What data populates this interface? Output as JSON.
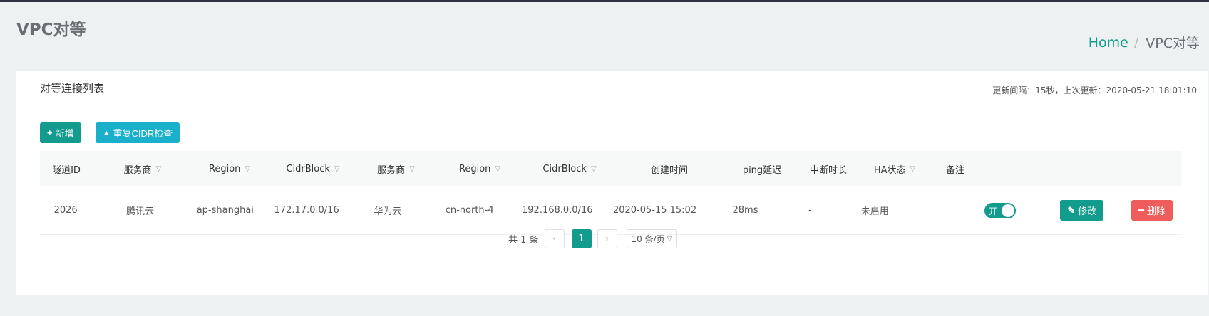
{
  "page": {
    "title": "VPC对等"
  },
  "breadcrumb": {
    "home": "Home",
    "separator": "/",
    "current": "VPC对等"
  },
  "card": {
    "title": "对等连接列表",
    "update_info": "更新间隔：15秒，上次更新：2020-05-21 18:01:10"
  },
  "toolbar": {
    "add_label": "新增",
    "add_icon": "+",
    "check_label": "重复CIDR检查",
    "check_icon": "▲"
  },
  "table": {
    "columns": [
      {
        "label": "隧道ID",
        "filter": false
      },
      {
        "label": "服务商",
        "filter": true
      },
      {
        "label": "Region",
        "filter": true
      },
      {
        "label": "CidrBlock",
        "filter": true
      },
      {
        "label": "服务商",
        "filter": true
      },
      {
        "label": "Region",
        "filter": true
      },
      {
        "label": "CidrBlock",
        "filter": true
      },
      {
        "label": "创建时间",
        "filter": false
      },
      {
        "label": "ping延迟",
        "filter": false
      },
      {
        "label": "中断时长",
        "filter": false
      },
      {
        "label": "HA状态",
        "filter": true
      },
      {
        "label": "备注",
        "filter": false
      }
    ],
    "rows": [
      {
        "tunnel_id": "2026",
        "provider_a": "腾讯云",
        "region_a": "ap-shanghai",
        "cidr_a": "172.17.0.0/16",
        "provider_b": "华为云",
        "region_b": "cn-north-4",
        "cidr_b": "192.168.0.0/16",
        "created": "2020-05-15 15:02",
        "ping": "28ms",
        "downtime": "-",
        "ha_status": "未启用",
        "note": "",
        "toggle_label": "开",
        "toggle_on": true,
        "edit_label": "修改",
        "delete_label": "删除"
      }
    ]
  },
  "pagination": {
    "total": "共 1 条",
    "prev": "‹",
    "current": "1",
    "next": "›",
    "page_size": "10 条/页"
  },
  "colors": {
    "primary": "#139b8d",
    "info": "#1ab0cc",
    "danger": "#ef5c5c"
  }
}
